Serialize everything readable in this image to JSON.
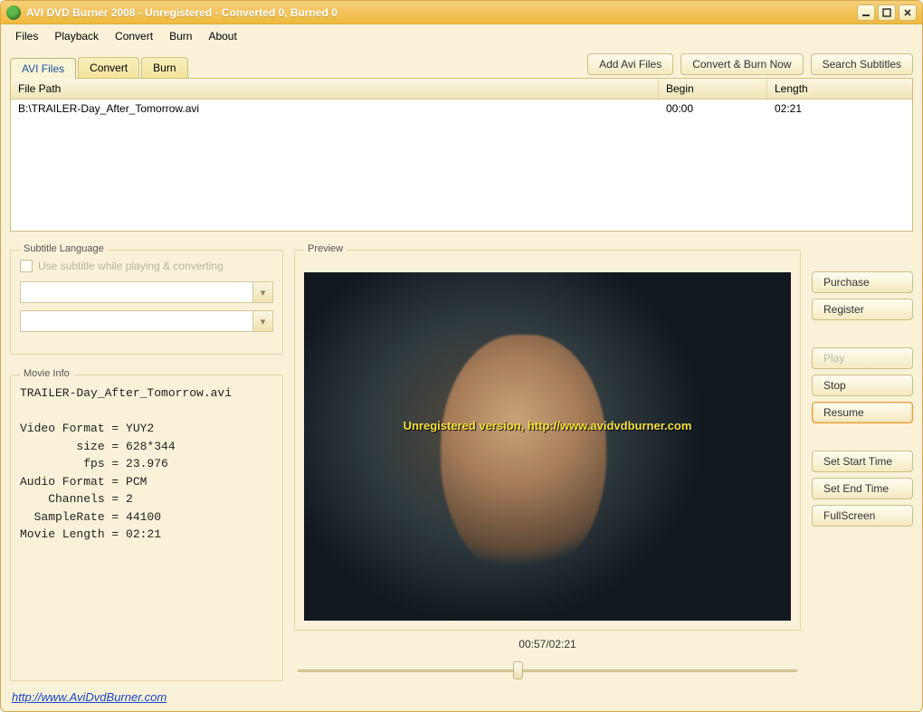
{
  "window": {
    "title": "AVI DVD Burner 2008 - Unregistered - Converted 0, Burned 0"
  },
  "menu": {
    "files": "Files",
    "playback": "Playback",
    "convert": "Convert",
    "burn": "Burn",
    "about": "About"
  },
  "tabs": {
    "avi": "AVI Files",
    "convert": "Convert",
    "burn": "Burn"
  },
  "actions": {
    "add": "Add Avi Files",
    "convertburn": "Convert & Burn Now",
    "search": "Search Subtitles"
  },
  "grid": {
    "headers": {
      "path": "File Path",
      "begin": "Begin",
      "length": "Length"
    },
    "rows": [
      {
        "path": "B:\\TRAILER-Day_After_Tomorrow.avi",
        "begin": "00:00",
        "length": "02:21"
      }
    ]
  },
  "subtitle": {
    "title": "Subtitle Language",
    "checkbox": "Use subtitle while playing & converting"
  },
  "movie": {
    "title": "Movie Info",
    "text": "TRAILER-Day_After_Tomorrow.avi\n\nVideo Format = YUY2\n        size = 628*344\n         fps = 23.976\nAudio Format = PCM\n    Channels = 2\n  SampleRate = 44100\nMovie Length = 02:21"
  },
  "preview": {
    "title": "Preview",
    "overlay": "Unregistered version, http://www.avidvdburner.com",
    "time": "00:57/02:21",
    "slider_pct": 44
  },
  "side": {
    "purchase": "Purchase",
    "register": "Register",
    "play": "Play",
    "stop": "Stop",
    "resume": "Resume",
    "setstart": "Set Start Time",
    "setend": "Set End Time",
    "fullscreen": "FullScreen"
  },
  "footer": {
    "link": "http://www.AviDvdBurner.com"
  }
}
